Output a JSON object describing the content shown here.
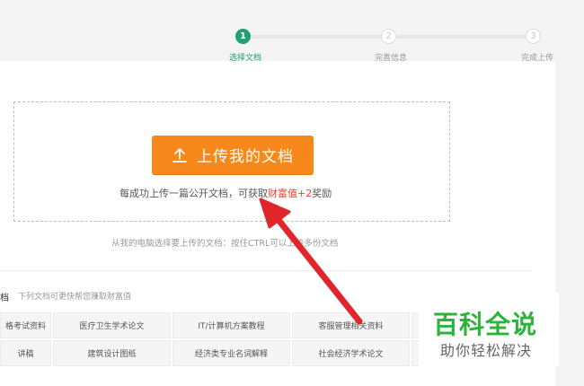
{
  "steps": [
    {
      "number": "1",
      "label": "选择文档",
      "state": "active"
    },
    {
      "number": "2",
      "label": "完善信息",
      "state": "todo"
    },
    {
      "number": "3",
      "label": "完成上传",
      "state": "todo"
    }
  ],
  "upload": {
    "button_label": "上传我的文档",
    "reward_prefix": "每成功上传一篇公开文档，可获取",
    "reward_highlight": "财富值+2",
    "reward_suffix": "奖励",
    "hint": "从我的电脑选择要上传的文档：按住CTRL可以上传多份文档"
  },
  "suggest": {
    "title": "档",
    "subtitle": "下列文档可更快帮您赚取财富值",
    "tags_row1": [
      "格考试资料",
      "医疗卫生学术论文",
      "IT/计算机方案教程",
      "客服管理相关资料"
    ],
    "tags_row2": [
      "讲稿",
      "建筑设计图纸",
      "经济类专业名词解释",
      "社会经济学术论文"
    ]
  },
  "watermark": {
    "title": "百科全说",
    "subtitle": "助你轻松解决"
  },
  "colors": {
    "accent_green": "#22a073",
    "button_orange": "#f7891c",
    "highlight_red": "#e8413a",
    "arrow_red": "#e0262b",
    "watermark_green": "#2db33a"
  }
}
